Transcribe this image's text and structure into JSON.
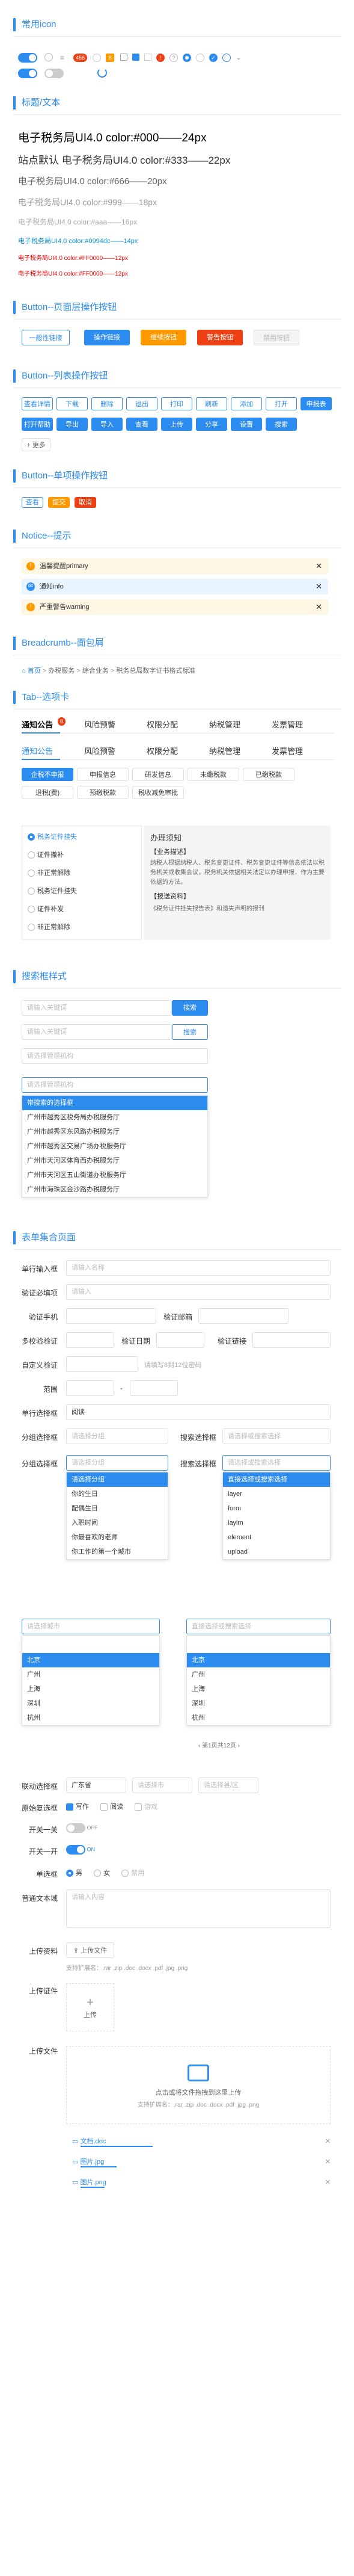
{
  "sections": {
    "icons": "常用icon",
    "title_text": "标题/文本",
    "btn_page": "Button--页面层操作按钮",
    "btn_list": "Button--列表操作按钮",
    "btn_single": "Button--单项操作按钮",
    "notice": "Notice--提示",
    "breadcrumb": "Breadcrumb--面包屑",
    "tabs": "Tab--选项卡",
    "search": "搜索框样式",
    "form": "表单集合页面"
  },
  "icons": {
    "badge_num": "456",
    "dot": "●"
  },
  "fonts": [
    "电子税务局UI4.0 color:#000——24px",
    "站点默认 电子税务局UI4.0 color:#333——22px",
    "电子税务局UI4.0 color:#666——20px",
    "电子税务局UI4.0 color:#999——18px",
    "电子税务局UI4.0 color:#aaa——16px",
    "电子税务局UI4.0 color:#0994dc——14px",
    "电子税务局UI4.0 color:#FF0000——12px",
    "电子税务局UI4.0 color:#FF0000——12px"
  ],
  "page_buttons": [
    "一般性链接",
    "操作链接",
    "继续按钮",
    "警告按钮",
    "禁用按钮"
  ],
  "list_buttons_row1": [
    "查看详情",
    "下载",
    "删除",
    "退出",
    "打印",
    "刷新",
    "添加",
    "打开",
    "申报表"
  ],
  "list_buttons_row2": [
    "打开帮助",
    "导出",
    "导入",
    "查看",
    "上传",
    "分享",
    "设置",
    "搜索"
  ],
  "list_button_more": "更多",
  "single_buttons": [
    "查看",
    "提交",
    "取消"
  ],
  "notices": [
    {
      "text": "温馨提醒primary",
      "icon": "!"
    },
    {
      "text": "通知info",
      "icon": "✉"
    },
    {
      "text": "严重警告warning",
      "icon": "!"
    }
  ],
  "breadcrumb": [
    "首页",
    "办税服务",
    "综合业务",
    "税务总局数字证书格式标准"
  ],
  "tabs1": [
    "通知公告",
    "风险预警",
    "权限分配",
    "纳税管理",
    "发票管理"
  ],
  "tabs1_badge": "8",
  "tabs2": [
    "通知公告",
    "风险预警",
    "权限分配",
    "纳税管理",
    "发票管理"
  ],
  "chips_row1": [
    "企税不申报",
    "申报信息",
    "研发信息",
    "未缴税款",
    "已缴税款"
  ],
  "chips_row2": [
    "退税(费)",
    "预缴税款",
    "税收减免审批"
  ],
  "side_list": [
    "税务证件挂失",
    "证件撤补",
    "非正常解除",
    "税务证件挂失",
    "证件补发",
    "非正常解除"
  ],
  "guide": {
    "title": "办理须知",
    "subtitle": "【业务描述】",
    "body": "纳税人根据纳税人、税务变更证件、税务变更证件等信息依法以税务机关或收集会议，税务机关依据相关法定以办理申报，作为主要依据的方法。",
    "subtitle2": "【报送资料】",
    "body2": "《税务证件挂失报告表》和遗失声明的报刊"
  },
  "search": {
    "placeholder": "请输入关键词",
    "btn": "搜索",
    "drop_placeholder": "请选择管理机构",
    "drop_selected": "带搜索的选择框",
    "options": [
      "带搜索的选择框",
      "广州市越秀区税务局办税服务厅",
      "广州市越秀区东风路办税服务厅",
      "广州市越秀区交易广场办税服务厅",
      "广州市天河区体育西办税服务厅",
      "广州市天河区五山街道办税服务厅",
      "广州市海珠区金沙路办税服务厅"
    ]
  },
  "form": {
    "labels": {
      "single_input": "单行输入框",
      "verify": "验证必填项",
      "phone": "验证手机",
      "range": "范围",
      "email": "验证邮箱",
      "idcard": "验证身份证",
      "date": "验证日期",
      "link": "验证链接",
      "multi": "多校验验证",
      "custom": "自定义验证",
      "single_select": "单行选择框",
      "group_select": "分组选择框",
      "search_select": "搜索选择框",
      "cascade": "联动选择框",
      "checkbox": "原始复选框",
      "switch1": "开关一关",
      "switch2": "开关一开",
      "radio": "单选框",
      "textarea": "普通文本域",
      "upload": "上传资料",
      "upload_img": "上传证件",
      "upload_file": "上传文件"
    },
    "placeholders": {
      "input": "请输入名称",
      "verify": "请输入",
      "custom": "请填写8到12位密码",
      "select": "请选择",
      "group": "请选择分组",
      "search": "请选择或搜索选择",
      "textarea": "请输入内容"
    },
    "range_sep": "-",
    "select_value": "阅读",
    "group_options": [
      "请选择分组",
      "你的生日",
      "配偶生日",
      "入职时间",
      "你最喜欢的老师",
      "你工作的第一个城市"
    ],
    "search_options": [
      "直接选择或搜索选择",
      "layer",
      "form",
      "layim",
      "element",
      "upload"
    ],
    "multi_options": [
      "北京",
      "广州",
      "上海",
      "深圳",
      "杭州"
    ],
    "multi_placeholder": "请选择城市",
    "multi2_placeholder": "直接选择或搜索选择",
    "pager": "第1页共12页",
    "cascade": [
      "广东省",
      "请选择市",
      "请选择县/区"
    ],
    "checks": [
      "写作",
      "阅读",
      "游戏"
    ],
    "switch_off": "OFF",
    "switch_on": "ON",
    "radios": [
      "男",
      "女",
      "禁用"
    ],
    "upload_btn": "上传文件",
    "upload_hint": "支持扩展名：.rar .zip .doc .docx .pdf .jpg .png",
    "upload_img_label": "上传",
    "dropzone": "点击或将文件拖拽到这里上传",
    "files": [
      "文档.doc",
      "图片.jpg",
      "图片.png"
    ]
  }
}
